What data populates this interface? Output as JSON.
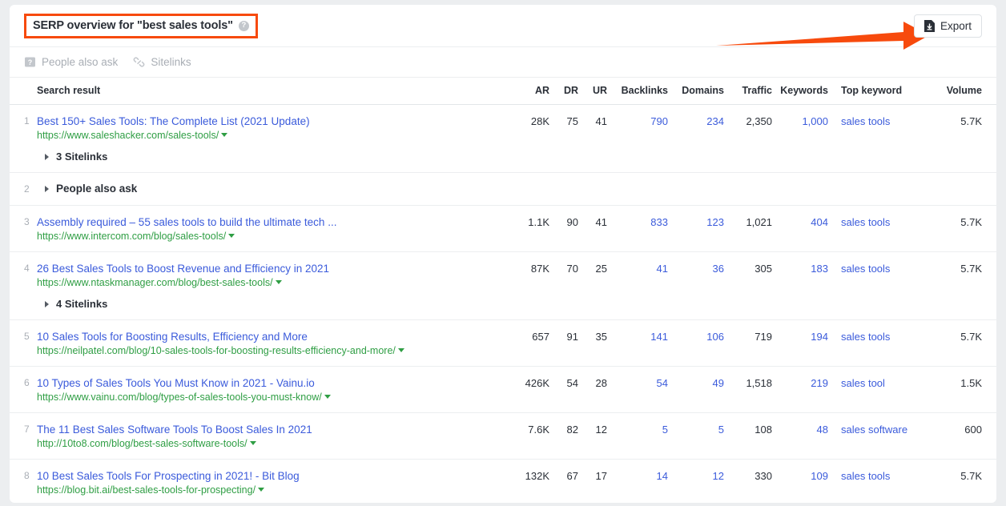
{
  "header": {
    "title": "SERP overview for \"best sales tools\"",
    "help_icon_char": "?",
    "export_label": "Export",
    "accent_color": "#f74a0d",
    "link_color": "#3b5bdb",
    "url_color": "#2f9e44"
  },
  "filters": [
    {
      "label": "People also ask",
      "icon": "people-also-ask-icon"
    },
    {
      "label": "Sitelinks",
      "icon": "link-icon"
    }
  ],
  "table": {
    "columns": {
      "search_result": "Search result",
      "ar": "AR",
      "dr": "DR",
      "ur": "UR",
      "backlinks": "Backlinks",
      "domains": "Domains",
      "traffic": "Traffic",
      "keywords": "Keywords",
      "top_keyword": "Top keyword",
      "volume": "Volume"
    },
    "rows": [
      {
        "type": "result",
        "rank": "1",
        "title": "Best 150+ Sales Tools: The Complete List (2021 Update)",
        "url": "https://www.saleshacker.com/sales-tools/",
        "sitelinks_label": "3 Sitelinks",
        "ar": "28K",
        "dr": "75",
        "ur": "41",
        "backlinks": "790",
        "domains": "234",
        "traffic": "2,350",
        "keywords": "1,000",
        "top_keyword": "sales tools",
        "volume": "5.7K"
      },
      {
        "type": "people_also_ask",
        "rank": "2",
        "label": "People also ask"
      },
      {
        "type": "result",
        "rank": "3",
        "title": "Assembly required – 55 sales tools to build the ultimate tech ...",
        "url": "https://www.intercom.com/blog/sales-tools/",
        "sitelinks_label": "",
        "ar": "1.1K",
        "dr": "90",
        "ur": "41",
        "backlinks": "833",
        "domains": "123",
        "traffic": "1,021",
        "keywords": "404",
        "top_keyword": "sales tools",
        "volume": "5.7K"
      },
      {
        "type": "result",
        "rank": "4",
        "title": "26 Best Sales Tools to Boost Revenue and Efficiency in 2021",
        "url": "https://www.ntaskmanager.com/blog/best-sales-tools/",
        "sitelinks_label": "4 Sitelinks",
        "ar": "87K",
        "dr": "70",
        "ur": "25",
        "backlinks": "41",
        "domains": "36",
        "traffic": "305",
        "keywords": "183",
        "top_keyword": "sales tools",
        "volume": "5.7K"
      },
      {
        "type": "result",
        "rank": "5",
        "title": "10 Sales Tools for Boosting Results, Efficiency and More",
        "url": "https://neilpatel.com/blog/10-sales-tools-for-boosting-results-efficiency-and-more/",
        "sitelinks_label": "",
        "ar": "657",
        "dr": "91",
        "ur": "35",
        "backlinks": "141",
        "domains": "106",
        "traffic": "719",
        "keywords": "194",
        "top_keyword": "sales tools",
        "volume": "5.7K"
      },
      {
        "type": "result",
        "rank": "6",
        "title": "10 Types of Sales Tools You Must Know in 2021 - Vainu.io",
        "url": "https://www.vainu.com/blog/types-of-sales-tools-you-must-know/",
        "sitelinks_label": "",
        "ar": "426K",
        "dr": "54",
        "ur": "28",
        "backlinks": "54",
        "domains": "49",
        "traffic": "1,518",
        "keywords": "219",
        "top_keyword": "sales tool",
        "volume": "1.5K"
      },
      {
        "type": "result",
        "rank": "7",
        "title": "The 11 Best Sales Software Tools To Boost Sales In 2021",
        "url": "http://10to8.com/blog/best-sales-software-tools/",
        "sitelinks_label": "",
        "ar": "7.6K",
        "dr": "82",
        "ur": "12",
        "backlinks": "5",
        "domains": "5",
        "traffic": "108",
        "keywords": "48",
        "top_keyword": "sales software",
        "volume": "600"
      },
      {
        "type": "result",
        "rank": "8",
        "title": "10 Best Sales Tools For Prospecting in 2021! - Bit Blog",
        "url": "https://blog.bit.ai/best-sales-tools-for-prospecting/",
        "sitelinks_label": "",
        "ar": "132K",
        "dr": "67",
        "ur": "17",
        "backlinks": "14",
        "domains": "12",
        "traffic": "330",
        "keywords": "109",
        "top_keyword": "sales tools",
        "volume": "5.7K"
      }
    ]
  }
}
